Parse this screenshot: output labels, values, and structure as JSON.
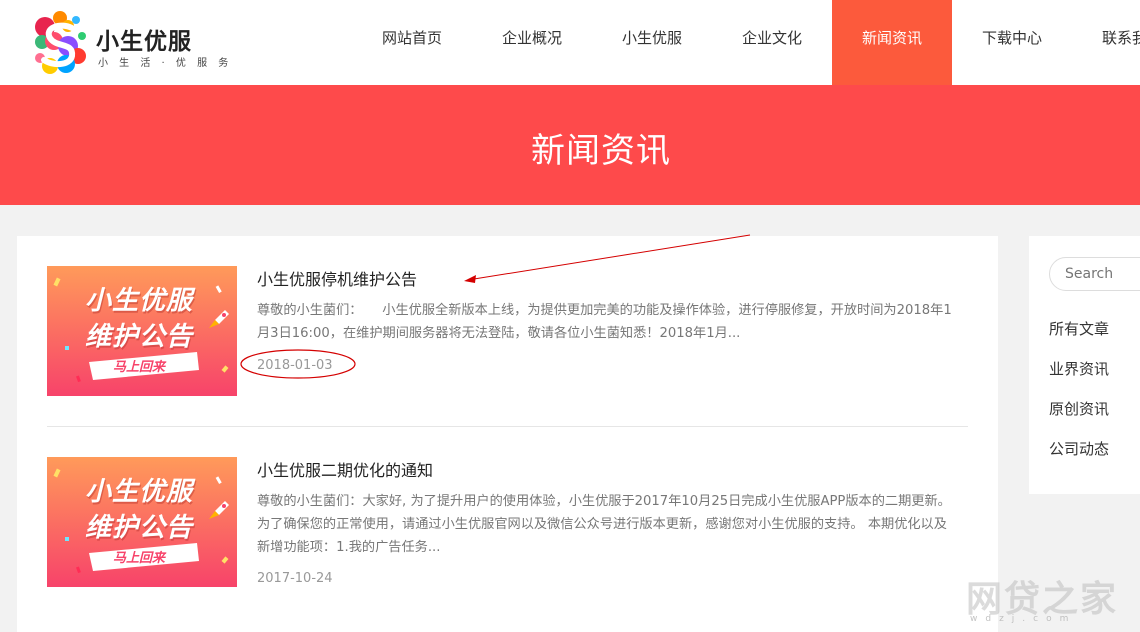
{
  "brand": {
    "name": "小生优服",
    "slogan": "小 生 活 · 优 服 务"
  },
  "nav": [
    {
      "label": "网站首页"
    },
    {
      "label": "企业概况"
    },
    {
      "label": "小生优服"
    },
    {
      "label": "企业文化"
    },
    {
      "label": "新闻资讯",
      "active": true
    },
    {
      "label": "下载中心"
    },
    {
      "label": "联系我们"
    }
  ],
  "banner": {
    "title": "新闻资讯"
  },
  "articles": [
    {
      "thumb_title": "小生优服",
      "thumb_sub": "维护公告",
      "thumb_tag": "马上回来",
      "title": "小生优服停机维护公告",
      "excerpt": "尊敬的小生菌们：　　小生优服全新版本上线，为提供更加完美的功能及操作体验，进行停服修复，开放时间为2018年1月3日16:00，在维护期间服务器将无法登陆，敬请各位小生菌知悉！2018年1月...",
      "date": "2018-01-03"
    },
    {
      "thumb_title": "小生优服",
      "thumb_sub": "维护公告",
      "thumb_tag": "马上回来",
      "title": "小生优服二期优化的通知",
      "excerpt": "尊敬的小生菌们：大家好, 为了提升用户的使用体验，小生优服于2017年10月25日完成小生优服APP版本的二期更新。为了确保您的正常使用，请通过小生优服官网以及微信公众号进行版本更新，感谢您对小生优服的支持。 本期优化以及新增功能项：1.我的广告任务...",
      "date": "2017-10-24"
    }
  ],
  "sidebar": {
    "search_placeholder": "Search",
    "links": [
      "所有文章",
      "业界资讯",
      "原创资讯",
      "公司动态"
    ]
  },
  "watermark": {
    "text": "网贷之家",
    "sub": "wdzj.com"
  },
  "colors": {
    "accent": "#fc5a3c",
    "banner": "#fe4a4b",
    "annotation": "#d40000"
  },
  "icons": {
    "rocket": "rocket-icon"
  }
}
